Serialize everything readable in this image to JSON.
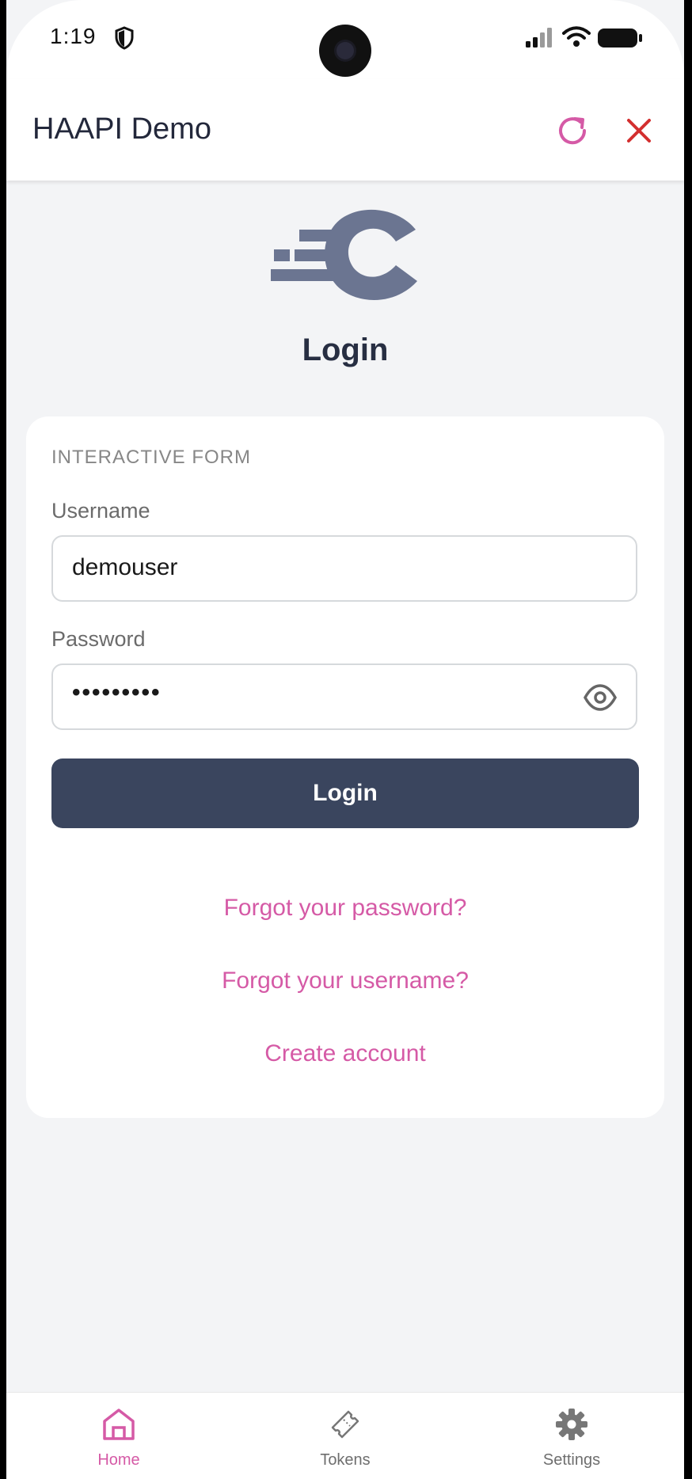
{
  "status_bar": {
    "time": "1:19",
    "icons": [
      "shield-icon",
      "signal-icon",
      "wifi-icon",
      "battery-icon"
    ]
  },
  "app_bar": {
    "title": "HAAPI Demo",
    "refresh_icon": "refresh-icon",
    "close_icon": "close-icon",
    "accent_color": "#d55aa6",
    "close_color": "#d32f2f"
  },
  "page": {
    "heading": "Login",
    "logo_color": "#6b7591"
  },
  "form": {
    "caption": "INTERACTIVE FORM",
    "username_label": "Username",
    "username_value": "demouser",
    "password_label": "Password",
    "password_value": "•••••••••",
    "submit_label": "Login",
    "button_color": "#3a455e"
  },
  "links": {
    "forgot_password": "Forgot your password?",
    "forgot_username": "Forgot your username?",
    "create_account": "Create account"
  },
  "bottom_nav": {
    "items": [
      {
        "label": "Home",
        "icon": "home-icon",
        "active": true
      },
      {
        "label": "Tokens",
        "icon": "ticket-icon",
        "active": false
      },
      {
        "label": "Settings",
        "icon": "gear-icon",
        "active": false
      }
    ]
  }
}
